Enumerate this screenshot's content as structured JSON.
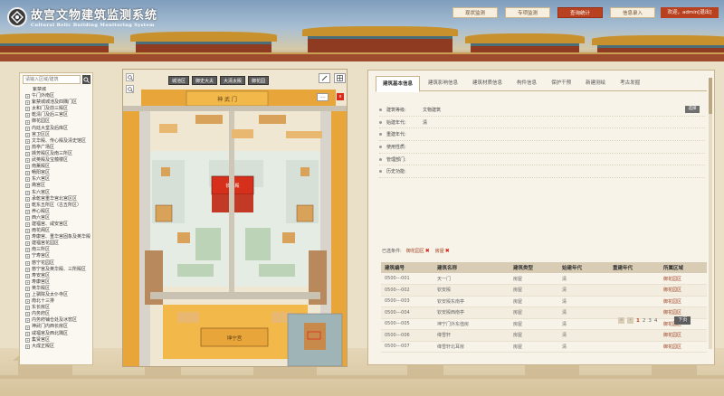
{
  "app": {
    "title": "故宫文物建筑监测系统",
    "subtitle": "Cultural Relic Building Monitoring System"
  },
  "nav": {
    "items": [
      {
        "label": "现状监测",
        "active": false
      },
      {
        "label": "专项监测",
        "active": false
      },
      {
        "label": "查询统计",
        "active": true
      },
      {
        "label": "信息录入",
        "active": false
      }
    ],
    "user": "欢迎，admin[退出]"
  },
  "sidebar": {
    "search_placeholder": "请输入区域/建筑",
    "root": "紫禁城",
    "items": [
      "午门外南区",
      "紫禁城城池及四隅门区",
      "太和门及前三殿区",
      "乾清门及后三宫区",
      "御花园区",
      "内廷大堂及后库区",
      "宫卫区区",
      "文华殿、传心殿及清史馆区",
      "箭亭广场区",
      "撷芳殿区及南三所区",
      "武英殿及宝蕴楼区",
      "南薰殿区",
      "畅阳宫区",
      "东六宫区",
      "斋宫区",
      "东六宫区",
      "承乾宫重华宫北宫区区",
      "乾东五所区（古五所区）",
      "养心殿区",
      "西六宫区",
      "建福宫、咸安宫区",
      "雨花阁区",
      "寿康宫、重华宫固象及英华殿区",
      "建福宫花园区",
      "南三所区",
      "宁寿宫区",
      "慈宁花园区",
      "慈宁宫及英华殿、三所殿区",
      "寿安宫区",
      "寿康宫区",
      "英华殿区",
      "上驷院及太仆寺区",
      "南北十三排",
      "东长房区",
      "内务府区",
      "内务府铺仓处及冰窖区",
      "神武门内西长房区",
      "咸福宫及西北隅区",
      "集贤宫区",
      "大成正殿区"
    ]
  },
  "map": {
    "layer_tabs": [
      "城池区",
      "御史大夫",
      "大清太殿",
      "御花园"
    ],
    "labels": {
      "north_gate": "神 武 门",
      "main_hall": "钦安殿",
      "south_palace": "坤宁宫"
    },
    "more_label": "....",
    "close_label": "x"
  },
  "detail": {
    "tabs": [
      "建筑基本信息",
      "建筑影响信息",
      "建筑材质信息",
      "构件信息",
      "保护干预",
      "新建测绘",
      "考古发掘"
    ],
    "active_tab": 0,
    "fields": [
      {
        "label": "建筑等级:",
        "value": "文物建筑"
      },
      {
        "label": "始建年代:",
        "value": "清"
      },
      {
        "label": "重建年代:",
        "value": ""
      },
      {
        "label": "使用性质:",
        "value": ""
      },
      {
        "label": "管理部门:",
        "value": ""
      },
      {
        "label": "历史功能:",
        "value": ""
      }
    ],
    "select_button": "选择",
    "conditions_label": "已选条件:",
    "conditions": [
      "御花园区",
      "房屋"
    ],
    "table": {
      "columns": [
        "建筑编号",
        "建筑名称",
        "建筑类型",
        "始建年代",
        "重建年代",
        "所属区域"
      ],
      "rows": [
        [
          "0500---001",
          "天一门",
          "房屋",
          "清",
          "",
          "御花园区"
        ],
        [
          "0500---002",
          "钦安殿",
          "房屋",
          "清",
          "",
          "御花园区"
        ],
        [
          "0500---003",
          "钦安殿东南亭",
          "房屋",
          "清",
          "",
          "御花园区"
        ],
        [
          "0500---004",
          "钦安殿西南亭",
          "房屋",
          "清",
          "",
          "御花园区"
        ],
        [
          "0500---005",
          "坤宁门外东值房",
          "房屋",
          "清",
          "",
          "御花园区"
        ],
        [
          "0500---006",
          "绛雪轩",
          "房屋",
          "清",
          "",
          "御花园区"
        ],
        [
          "0500---007",
          "绛雪轩北耳房",
          "房屋",
          "清",
          "",
          "御花园区"
        ]
      ]
    },
    "pager": {
      "pages": [
        "1",
        "2",
        "3",
        "4"
      ],
      "current": "1",
      "next_label": "下页"
    }
  }
}
